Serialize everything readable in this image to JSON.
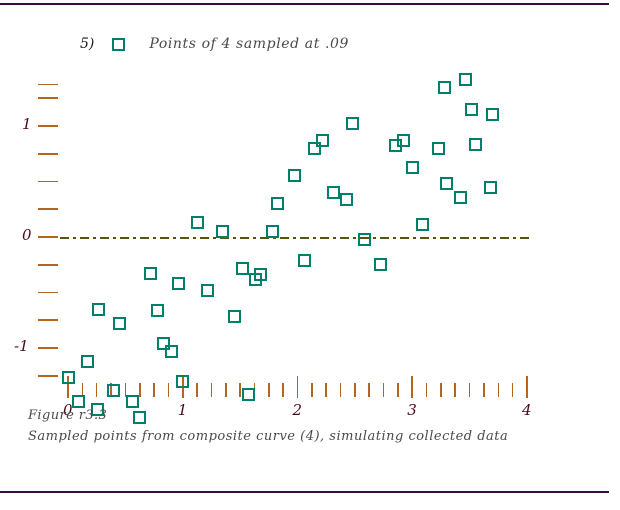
{
  "figure": {
    "legend_number": "5)",
    "legend_text": "Points of 4 sampled at .09",
    "caption_line1": "Figure r3.3",
    "caption_line2": "Sampled points from composite curve (4), simulating collected data",
    "marker_icon": "open-square-marker"
  },
  "colors": {
    "marker": "#00806a",
    "axis_tick": "#b5651d",
    "axis_label": "#4a0a14",
    "zero_line": "#5c5208",
    "rule": "#3d0a3d",
    "caption": "#4a4a4a"
  },
  "chart_data": {
    "type": "scatter",
    "title": "Points of 4 sampled at .09",
    "subtitle": "Figure r3.3",
    "annotation": "Sampled points from composite curve (4), simulating collected data",
    "xlabel": "",
    "ylabel": "",
    "xlim": [
      -0.12,
      4.2
    ],
    "ylim": [
      -1.62,
      1.45
    ],
    "xticks_major": [
      0,
      1,
      2,
      3,
      4
    ],
    "xticklabels": [
      "0",
      "1",
      "2",
      "3",
      "4"
    ],
    "xtick_minor_step": 0.125,
    "yticks_major": [
      -1,
      0,
      1
    ],
    "yticklabels": [
      "-1",
      "0",
      "1"
    ],
    "ytick_all": [
      1.25,
      1.0,
      0.75,
      0.5,
      0.25,
      0.0,
      -0.25,
      -0.5,
      -0.75,
      -1.0,
      -1.25
    ],
    "grid": false,
    "zero_line": true,
    "legend_position": "top",
    "marker_style": "open square",
    "series": [
      {
        "name": "Points of 4 sampled at .09",
        "points": [
          [
            0.0,
            -1.27
          ],
          [
            0.09,
            -1.48
          ],
          [
            0.17,
            -1.12
          ],
          [
            0.26,
            -1.55
          ],
          [
            0.27,
            -0.65
          ],
          [
            0.4,
            -1.38
          ],
          [
            0.45,
            -0.78
          ],
          [
            0.56,
            -1.48
          ],
          [
            0.62,
            -1.63
          ],
          [
            0.72,
            -0.33
          ],
          [
            0.78,
            -0.66
          ],
          [
            0.83,
            -0.96
          ],
          [
            0.9,
            -1.03
          ],
          [
            0.96,
            -0.42
          ],
          [
            1.0,
            -1.3
          ],
          [
            1.13,
            0.13
          ],
          [
            1.22,
            -0.48
          ],
          [
            1.35,
            0.05
          ],
          [
            1.45,
            -0.72
          ],
          [
            1.52,
            -0.28
          ],
          [
            1.57,
            -1.42
          ],
          [
            1.63,
            -0.38
          ],
          [
            1.68,
            -0.34
          ],
          [
            1.78,
            0.05
          ],
          [
            1.83,
            0.3
          ],
          [
            1.97,
            0.55
          ],
          [
            2.06,
            -0.21
          ],
          [
            2.15,
            0.8
          ],
          [
            2.22,
            0.87
          ],
          [
            2.31,
            0.4
          ],
          [
            2.43,
            0.34
          ],
          [
            2.48,
            1.02
          ],
          [
            2.58,
            -0.02
          ],
          [
            2.72,
            -0.25
          ],
          [
            2.85,
            0.82
          ],
          [
            2.92,
            0.87
          ],
          [
            3.0,
            0.63
          ],
          [
            3.09,
            0.11
          ],
          [
            3.23,
            0.8
          ],
          [
            3.3,
            0.48
          ],
          [
            3.42,
            0.36
          ],
          [
            3.55,
            0.83
          ],
          [
            3.68,
            0.45
          ],
          [
            3.28,
            1.35
          ],
          [
            3.46,
            1.42
          ],
          [
            3.52,
            1.15
          ],
          [
            3.7,
            1.1
          ]
        ]
      }
    ]
  }
}
